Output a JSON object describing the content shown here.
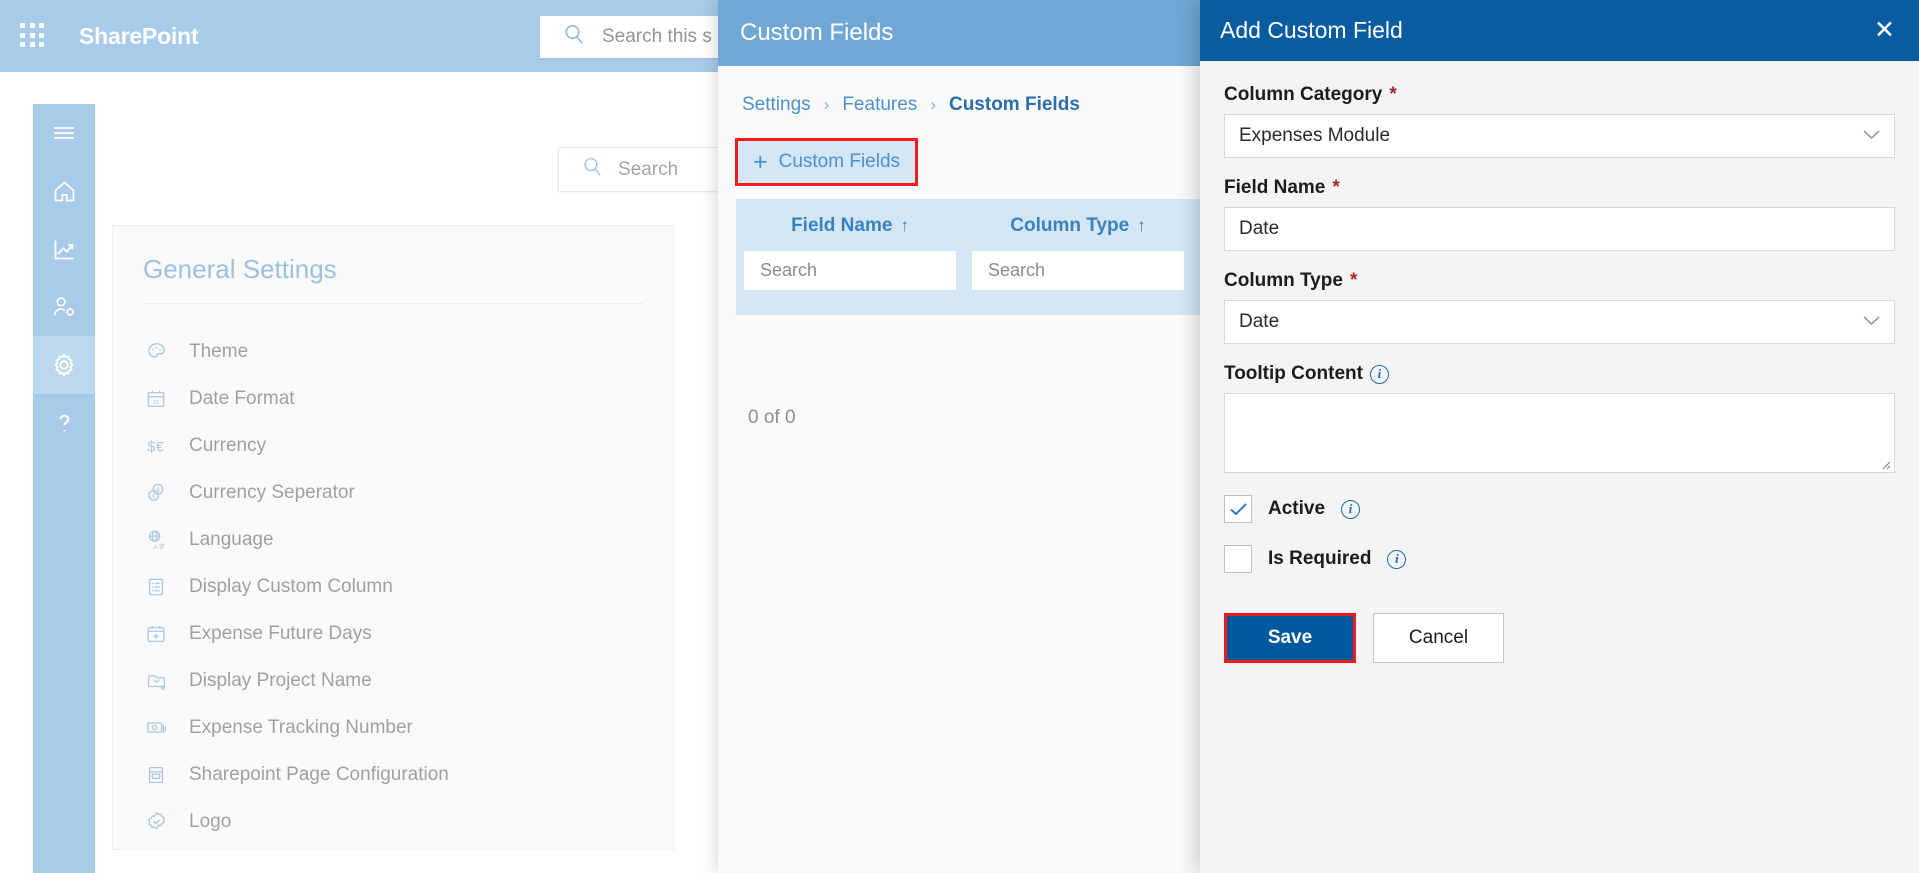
{
  "suite": {
    "brand": "SharePoint",
    "search_placeholder": "Search this s",
    "waffle_icon": "app-launcher-icon",
    "search_icon": "search-icon"
  },
  "rail": {
    "items": [
      {
        "name": "hamburger",
        "icon": "hamburger-menu-icon",
        "active": false
      },
      {
        "name": "home",
        "icon": "home-icon",
        "active": false
      },
      {
        "name": "analytics",
        "icon": "chart-line-icon",
        "active": false
      },
      {
        "name": "user-settings",
        "icon": "user-gear-icon",
        "active": false
      },
      {
        "name": "settings",
        "icon": "gear-icon",
        "active": true
      },
      {
        "name": "help",
        "icon": "question-mark-icon",
        "active": false
      }
    ]
  },
  "content_search": {
    "placeholder": "Search",
    "icon": "search-icon"
  },
  "general_settings": {
    "title": "General Settings",
    "items": [
      {
        "label": "Theme",
        "icon": "palette-icon"
      },
      {
        "label": "Date Format",
        "icon": "calendar-21-icon"
      },
      {
        "label": "Currency",
        "icon": "dollar-euro-icon"
      },
      {
        "label": "Currency Seperator",
        "icon": "coins-icon"
      },
      {
        "label": "Language",
        "icon": "globe-translate-icon"
      },
      {
        "label": "Display Custom Column",
        "icon": "list-document-icon"
      },
      {
        "label": "Expense Future Days",
        "icon": "calendar-plus-icon"
      },
      {
        "label": "Display Project Name",
        "icon": "folder-add-icon"
      },
      {
        "label": "Expense Tracking Number",
        "icon": "banknote-icon"
      },
      {
        "label": "Sharepoint Page Configuration",
        "icon": "page-layout-icon"
      },
      {
        "label": "Logo",
        "icon": "badge-check-icon"
      }
    ]
  },
  "custom_fields_panel": {
    "header_title": "Custom Fields",
    "breadcrumb": [
      "Settings",
      "Features",
      "Custom Fields"
    ],
    "breadcrumb_separator": "›",
    "add_button_label": "Custom Fields",
    "add_button_icon": "plus-icon",
    "grid": {
      "columns": [
        {
          "header": "Field Name",
          "sort": "↑",
          "search_placeholder": "Search"
        },
        {
          "header": "Column Type",
          "sort": "↑",
          "search_placeholder": "Search"
        }
      ],
      "rows": [],
      "count_text": "0 of 0"
    }
  },
  "dialog": {
    "title": "Add Custom Field",
    "close_label": "✕",
    "fields": {
      "column_category": {
        "label": "Column Category",
        "required_marker": "*",
        "value": "Expenses Module",
        "chevron": "⌄"
      },
      "field_name": {
        "label": "Field Name",
        "required_marker": "*",
        "value": "Date"
      },
      "column_type": {
        "label": "Column Type",
        "required_marker": "*",
        "value": "Date",
        "chevron": "⌄"
      },
      "tooltip_content": {
        "label": "Tooltip Content",
        "info_icon": "info-icon",
        "value": ""
      }
    },
    "checkboxes": [
      {
        "label": "Active",
        "checked": true,
        "info_icon": "info-icon"
      },
      {
        "label": "Is Required",
        "checked": false,
        "info_icon": "info-icon"
      }
    ],
    "buttons": {
      "save": "Save",
      "cancel": "Cancel"
    }
  },
  "colors": {
    "suite_bar": "#a7cbe8",
    "rail": "#a7cbe8",
    "rail_active": "#bcd9f0",
    "mid_header": "#6fa8d4",
    "grid_head": "#d4e7f6",
    "dialog_header": "#0a5ca0",
    "save_button": "#00599c",
    "highlight_outline": "#f21a1a",
    "required_star": "#a4262c",
    "link_blue": "#4a91cd"
  }
}
